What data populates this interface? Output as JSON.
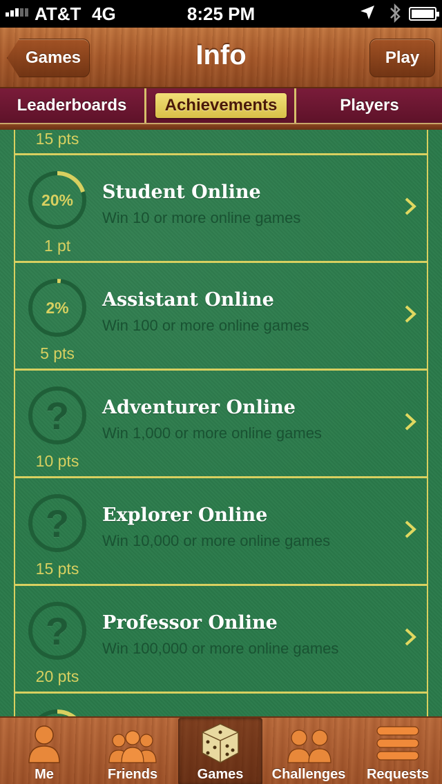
{
  "status": {
    "carrier": "AT&T",
    "network": "4G",
    "time": "8:25 PM"
  },
  "nav": {
    "back_label": "Games",
    "title": "Info",
    "play_label": "Play"
  },
  "segments": [
    {
      "label": "Leaderboards",
      "active": false
    },
    {
      "label": "Achievements",
      "active": true
    },
    {
      "label": "Players",
      "active": false
    }
  ],
  "top_partial_pts": "15 pts",
  "achievements": [
    {
      "title": "Student Online",
      "description": "Win 10 or more online games",
      "points": "1 pt",
      "progress": "20%",
      "progress_value": 20,
      "locked": false
    },
    {
      "title": "Assistant Online",
      "description": "Win 100 or more online games",
      "points": "5 pts",
      "progress": "2%",
      "progress_value": 2,
      "locked": false
    },
    {
      "title": "Adventurer Online",
      "description": "Win 1,000 or more online games",
      "points": "10 pts",
      "progress": "?",
      "progress_value": 0,
      "locked": true
    },
    {
      "title": "Explorer Online",
      "description": "Win 10,000 or more online games",
      "points": "15 pts",
      "progress": "?",
      "progress_value": 0,
      "locked": true
    },
    {
      "title": "Professor Online",
      "description": "Win 100,000 or more online games",
      "points": "20 pts",
      "progress": "?",
      "progress_value": 0,
      "locked": true
    }
  ],
  "tabs": [
    {
      "label": "Me",
      "icon": "person-icon",
      "active": false
    },
    {
      "label": "Friends",
      "icon": "friends-icon",
      "active": false
    },
    {
      "label": "Games",
      "icon": "dice-icon",
      "active": true
    },
    {
      "label": "Challenges",
      "icon": "challenges-icon",
      "active": false
    },
    {
      "label": "Requests",
      "icon": "requests-icon",
      "active": false
    }
  ],
  "colors": {
    "felt": "#2a7a4a",
    "gold": "#d8d060",
    "wood": "#a6582a",
    "burgundy": "#6a1832"
  }
}
